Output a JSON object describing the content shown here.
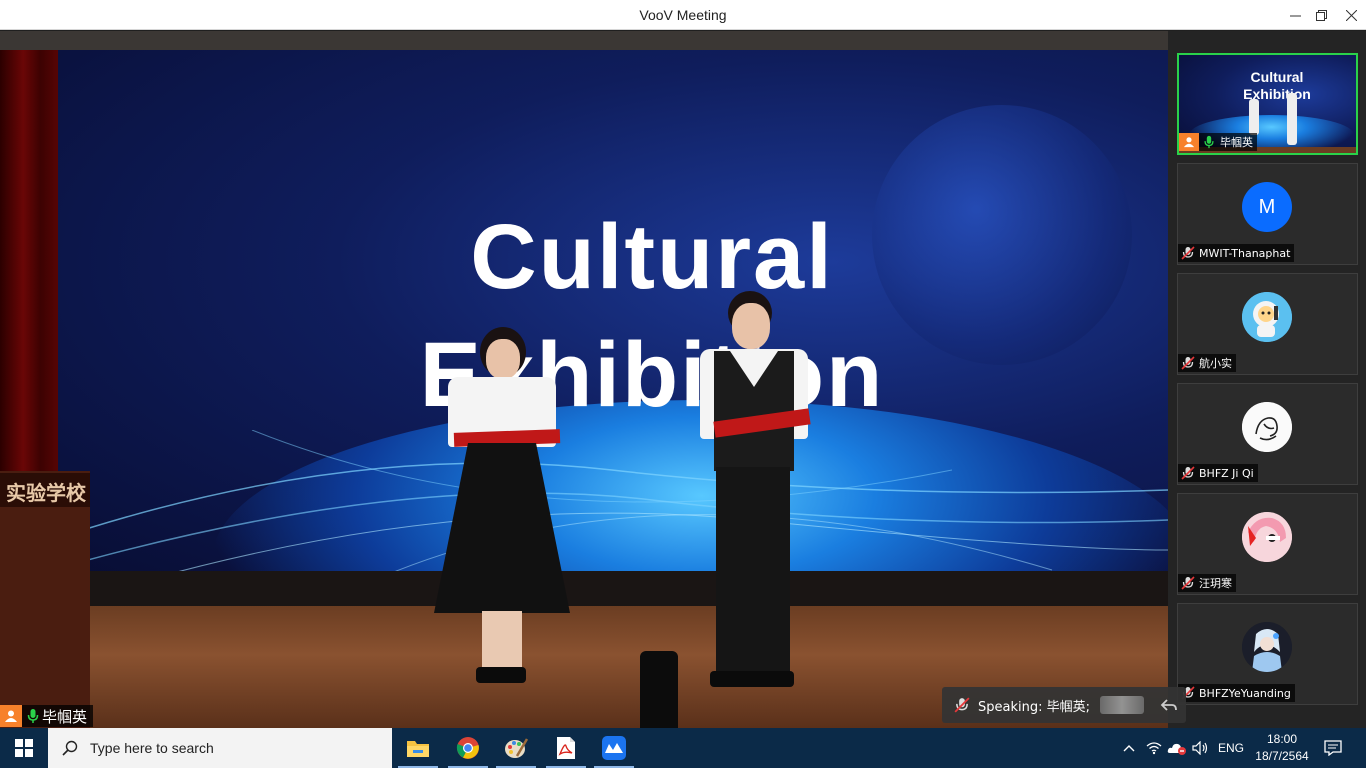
{
  "window": {
    "title": "VooV Meeting",
    "controls": [
      "minimize-icon",
      "restore-icon",
      "close-icon"
    ]
  },
  "stage": {
    "slide_title_line1": "Cultural",
    "slide_title_line2": "Exhibition",
    "podium_text": "实验学校",
    "speaker_label": "毕帼英"
  },
  "participants": [
    {
      "name": "毕帼英",
      "type": "video",
      "active": true,
      "mic": "on",
      "thumb_title_line1": "Cultural",
      "thumb_title_line2": "Exhibition"
    },
    {
      "name": "MWIT-Thanaphat",
      "type": "letter",
      "letter": "M",
      "mic": "muted"
    },
    {
      "name": "航小实",
      "type": "avatar",
      "avatar_icon": "astronaut-avatar-icon",
      "mic": "muted"
    },
    {
      "name": "BHFZ Ji Qi",
      "type": "avatar",
      "avatar_icon": "sketch-hand-avatar-icon",
      "mic": "muted"
    },
    {
      "name": "汪玥寒",
      "type": "avatar",
      "avatar_icon": "anime-girl-avatar-icon",
      "mic": "muted"
    },
    {
      "name": "BHFZYeYuanding",
      "type": "avatar",
      "avatar_icon": "anime-character-avatar-icon",
      "mic": "muted"
    }
  ],
  "toast": {
    "text": "Speaking: 毕帼英;"
  },
  "taskbar": {
    "search_placeholder": "Type here to search",
    "apps": [
      "file-explorer-icon",
      "chrome-icon",
      "paint-icon",
      "acrobat-icon",
      "voov-meeting-icon"
    ],
    "language": "ENG",
    "time": "18:00",
    "date": "18/7/2564"
  },
  "colors": {
    "active_border": "#2ad24a",
    "avatar_orange": "#f7812b",
    "letter_avatar_blue": "#0a6cff",
    "taskbar_bg": "#0b2a48"
  }
}
